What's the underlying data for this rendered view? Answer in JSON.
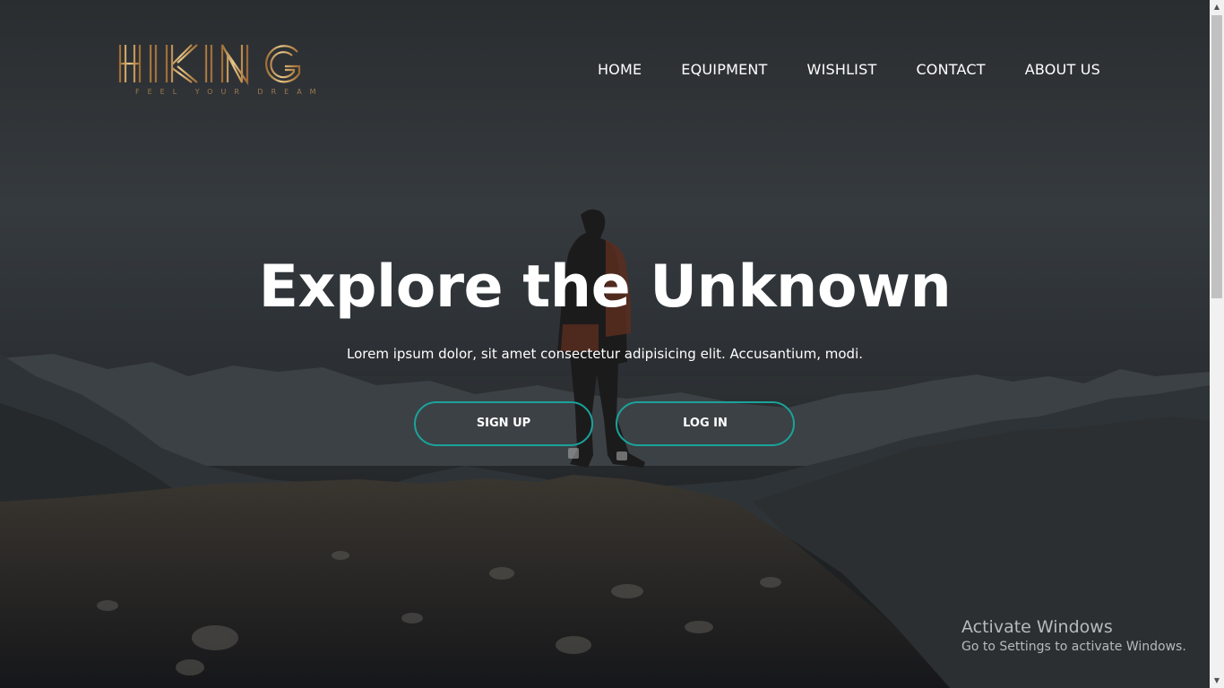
{
  "logo": {
    "wordmark": "HIKING",
    "tagline": "FEEL YOUR DREAM",
    "gold_light": "#e8c88a",
    "gold_dark": "#9a6a36"
  },
  "nav": {
    "items": [
      {
        "label": "HOME"
      },
      {
        "label": "EQUIPMENT"
      },
      {
        "label": "WISHLIST"
      },
      {
        "label": "CONTACT"
      },
      {
        "label": "ABOUT US"
      }
    ]
  },
  "hero": {
    "title": "Explore the Unknown",
    "subtitle": "Lorem ipsum dolor, sit amet consectetur adipisicing elit. Accusantium, modi.",
    "background_image": "hiker-on-mountain-peak-icon",
    "buttons": {
      "signup_label": "SIGN UP",
      "login_label": "LOG IN"
    },
    "button_border_color": "#1aa39a"
  },
  "watermark": {
    "title": "Activate Windows",
    "subtitle": "Go to Settings to activate Windows."
  },
  "scrollbar": {
    "up_icon": "scroll-up-arrow-icon",
    "down_icon": "scroll-down-arrow-icon"
  }
}
